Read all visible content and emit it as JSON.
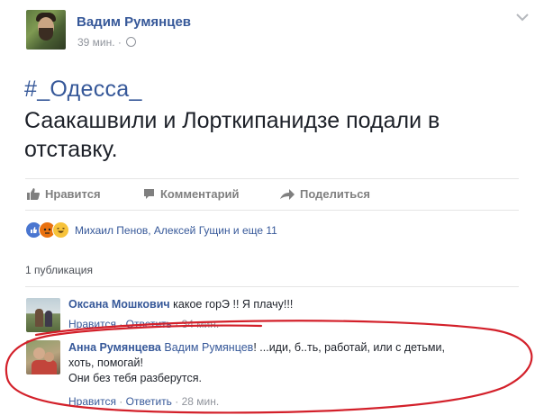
{
  "post": {
    "author": "Вадим Румянцев",
    "time": "39 мин. ·",
    "hashtag": "#_Одесса_",
    "text": "Саакашвили и Лорткипанидзе подали в отставку."
  },
  "actions": {
    "like": "Нравится",
    "comment": "Комментарий",
    "share": "Поделиться"
  },
  "reactions": {
    "summary": "Михаил Пенов, Алексей Гущин и еще 11",
    "icons": [
      "like-reaction",
      "angry-reaction",
      "haha-reaction"
    ]
  },
  "shares": "1 публикация",
  "comments": [
    {
      "author": "Оксана Мошкович",
      "text": " какое горЭ !! Я плачу!!!",
      "like": "Нравится",
      "sep1": " · ",
      "reply": "Ответить",
      "time": " · 34 мин."
    },
    {
      "author": "Анна Румянцева",
      "mention": "Вадим Румянцев",
      "text_line1": "! ...иди, б..ть, работай, или с детьми,",
      "text_line2": "хоть, помогай!",
      "text_line3": "Они без тебя разберутся.",
      "like": "Нравится",
      "sep1": " · ",
      "reply": "Ответить",
      "time": " · 28 мин."
    }
  ],
  "colors": {
    "link": "#365899",
    "annotation_ring": "#d3202a"
  }
}
